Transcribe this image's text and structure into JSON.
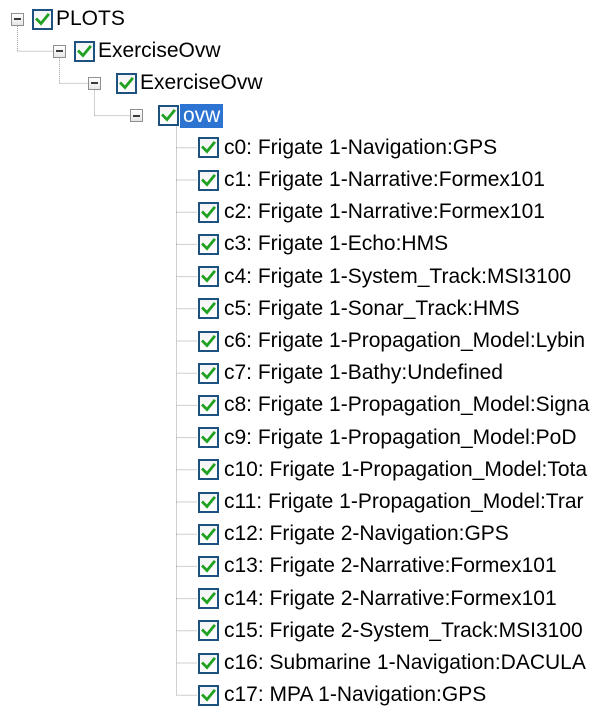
{
  "tree": {
    "root": {
      "label": "PLOTS",
      "checked": true,
      "expanded": true,
      "icon_expander": "minus-box-icon",
      "icon_check": "checkmark-icon"
    },
    "level1": {
      "label": "ExerciseOvw",
      "checked": true,
      "expanded": true
    },
    "level2": {
      "label": "ExerciseOvw",
      "checked": true,
      "expanded": true
    },
    "level3": {
      "label": "ovw",
      "checked": true,
      "expanded": true,
      "selected": true
    },
    "channels": [
      {
        "label": "c0: Frigate 1-Navigation:GPS",
        "checked": true
      },
      {
        "label": "c1: Frigate 1-Narrative:Formex101",
        "checked": true
      },
      {
        "label": "c2: Frigate 1-Narrative:Formex101",
        "checked": true
      },
      {
        "label": "c3: Frigate 1-Echo:HMS",
        "checked": true
      },
      {
        "label": "c4: Frigate 1-System_Track:MSI3100",
        "checked": true
      },
      {
        "label": "c5: Frigate 1-Sonar_Track:HMS",
        "checked": true
      },
      {
        "label": "c6: Frigate 1-Propagation_Model:Lybin",
        "checked": true
      },
      {
        "label": "c7: Frigate 1-Bathy:Undefined",
        "checked": true
      },
      {
        "label": "c8: Frigate 1-Propagation_Model:Signa",
        "checked": true
      },
      {
        "label": "c9: Frigate 1-Propagation_Model:PoD",
        "checked": true
      },
      {
        "label": "c10: Frigate 1-Propagation_Model:Tota",
        "checked": true
      },
      {
        "label": "c11: Frigate 1-Propagation_Model:Trar",
        "checked": true
      },
      {
        "label": "c12: Frigate 2-Navigation:GPS",
        "checked": true
      },
      {
        "label": "c13: Frigate 2-Narrative:Formex101",
        "checked": true
      },
      {
        "label": "c14: Frigate 2-Narrative:Formex101",
        "checked": true
      },
      {
        "label": "c15: Frigate 2-System_Track:MSI3100",
        "checked": true
      },
      {
        "label": "c16: Submarine 1-Navigation:DACULA",
        "checked": true
      },
      {
        "label": "c17: MPA 1-Navigation:GPS",
        "checked": true
      }
    ]
  },
  "colors": {
    "check_border": "#1c5180",
    "check_mark": "#21a121",
    "selection_bg": "#2c73d2",
    "selection_text": "#ffffff",
    "tree_line": "#a0a0a0",
    "expander_border": "#8e8f8f"
  }
}
